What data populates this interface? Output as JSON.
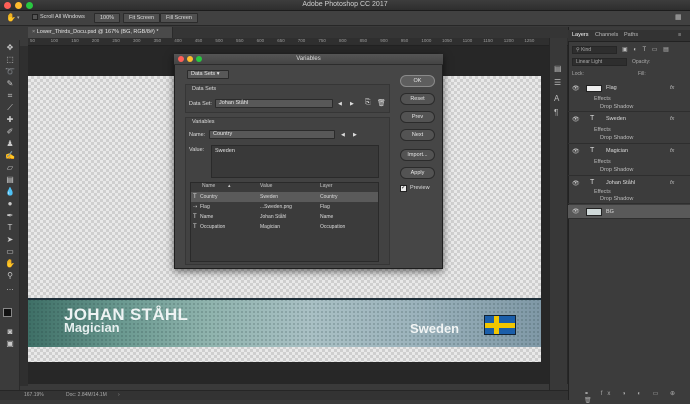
{
  "window": {
    "title": "Adobe Photoshop CC 2017"
  },
  "options_bar": {
    "scroll_all": "Scroll All Windows",
    "zoom": "100%",
    "fit_screen": "Fit Screen",
    "fill_screen": "Fill Screen"
  },
  "document": {
    "tab": "Lower_Thirds_Docu.psd @ 167% (BG, RGB/8#) *"
  },
  "ruler": {
    "ticks": [
      "50",
      "100",
      "150",
      "200",
      "250",
      "300",
      "350",
      "400",
      "450",
      "500",
      "550",
      "600",
      "650",
      "700",
      "750",
      "800",
      "850",
      "900",
      "950",
      "1000",
      "1050",
      "1100",
      "1150",
      "1200",
      "1250"
    ]
  },
  "lower_third": {
    "name": "JOHAN STÅHL",
    "occupation": "Magician",
    "country": "Sweden"
  },
  "status": {
    "zoom": "167.19%",
    "doc": "Doc: 2.84M/14.1M"
  },
  "panel": {
    "tabs": [
      "Layers",
      "Channels",
      "Paths"
    ],
    "kind": "Kind",
    "blend": "Linear Light",
    "opacity_label": "Opacity:",
    "lock_label": "Lock:",
    "fill_label": "Fill:",
    "layers": [
      {
        "name": "Flag",
        "kind": "image",
        "effects": "Effects",
        "effect": "Drop Shadow"
      },
      {
        "name": "Sweden",
        "kind": "text",
        "effects": "Effects",
        "effect": "Drop Shadow"
      },
      {
        "name": "Magician",
        "kind": "text",
        "effects": "Effects",
        "effect": "Drop Shadow"
      },
      {
        "name": "Johan Ståhl",
        "kind": "text",
        "effects": "Effects",
        "effect": "Drop Shadow"
      },
      {
        "name": "BG",
        "kind": "image"
      }
    ]
  },
  "dialog": {
    "title": "Variables",
    "mode": "Data Sets",
    "dataset_group": "Data Sets",
    "dataset_label": "Data Set:",
    "dataset_value": "Johan Ståhl",
    "variables_group": "Variables",
    "name_label": "Name:",
    "name_value": "Country",
    "value_label": "Value:",
    "value_text": "Sweden",
    "columns": [
      "Name",
      "Value",
      "Layer"
    ],
    "rows": [
      {
        "name": "Country",
        "value": "Sweden",
        "layer": "Country"
      },
      {
        "name": "Flag",
        "value": "...Sweden.png",
        "layer": "Flag"
      },
      {
        "name": "Name",
        "value": "Johan Ståhl",
        "layer": "Name"
      },
      {
        "name": "Occupation",
        "value": "Magician",
        "layer": "Occupation"
      }
    ],
    "buttons": {
      "ok": "OK",
      "reset": "Reset",
      "prev": "Prev",
      "next": "Next",
      "import": "Import...",
      "apply": "Apply"
    },
    "preview": "Preview"
  },
  "colors": {
    "flag_blue": "#1b5ea9",
    "flag_yellow": "#f2c600"
  }
}
